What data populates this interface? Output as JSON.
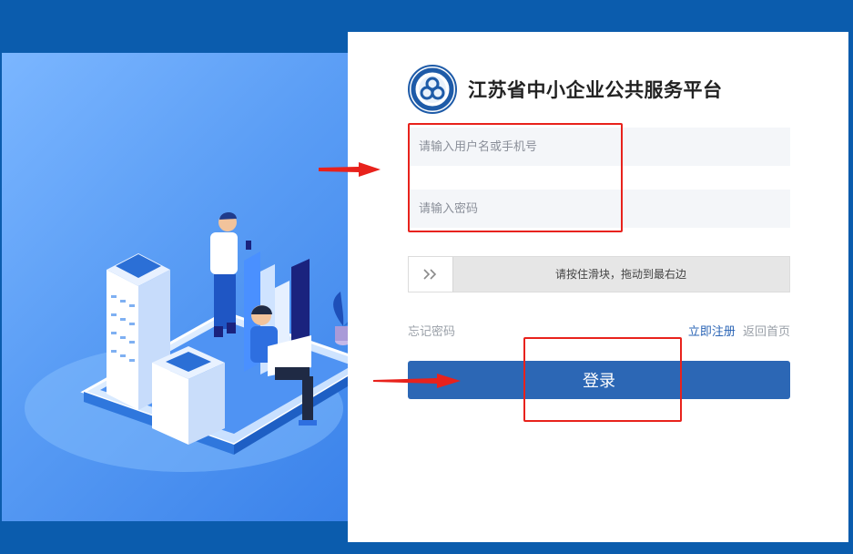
{
  "brand": {
    "title": "江苏省中小企业公共服务平台",
    "logo_icon": "emblem-logo-icon"
  },
  "login_form": {
    "username_placeholder": "请输入用户名或手机号",
    "password_placeholder": "请输入密码",
    "slider_text": "请按住滑块，拖动到最右边",
    "slider_handle_icon": "double-chevron-right-icon",
    "forgot_password": "忘记密码",
    "register_link": "立即注册",
    "back_home_link": "返回首页",
    "login_button": "登录"
  },
  "colors": {
    "page_background": "#0b5cad",
    "primary_button": "#2c67b5",
    "link_blue": "#2a64b5",
    "annotation_red": "#e8221c"
  }
}
